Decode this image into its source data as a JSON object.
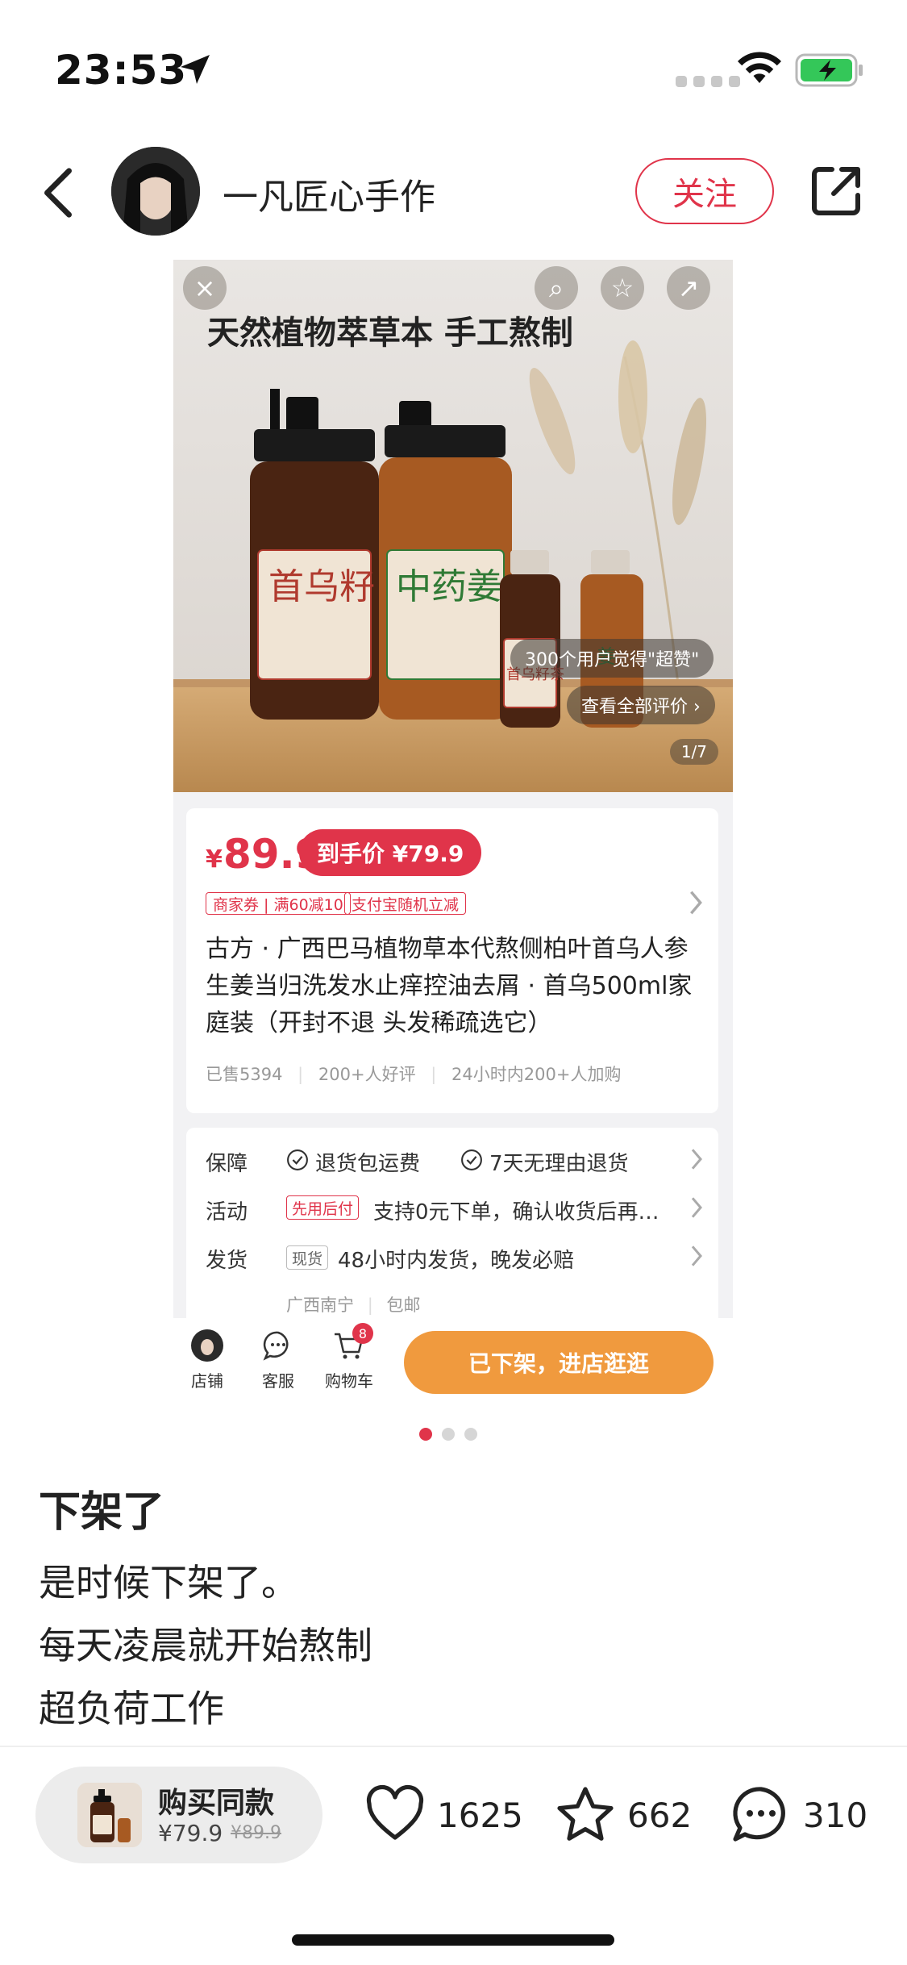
{
  "status_bar": {
    "time": "23:53"
  },
  "nav": {
    "shop_name": "一凡匠心手作",
    "follow_label": "关注"
  },
  "product": {
    "banner": "天然植物萃草本 手工熬制",
    "bottle_labels": [
      "首乌籽",
      "中药姜",
      "首乌籽茶",
      "姜"
    ],
    "review_bubble": "300个用户觉得\"超赞\"",
    "all_reviews": "查看全部评价 ›",
    "page_indicator": "1/7",
    "price_symbol": "¥",
    "price": "89.9",
    "deal_price": "到手价 ¥79.9",
    "coupons": [
      "商家券 | 满60减10",
      "支付宝随机立减"
    ],
    "title": "古方 · 广西巴马植物草本代熬侧柏叶首乌人参生姜当归洗发水止痒控油去屑 · 首乌500ml家庭装（开封不退 头发稀疏选它）",
    "sold": "已售5394",
    "good_reviews": "200+人好评",
    "recent": "24小时内200+人加购",
    "service": {
      "guarantee_label": "保障",
      "guarantee_1": "退货包运费",
      "guarantee_2": "7天无理由退货",
      "activity_label": "活动",
      "activity_tag": "先用后付",
      "activity_text": "支持0元下单，确认收货后再…",
      "ship_label": "发货",
      "ship_tag": "现货",
      "ship_text": "48小时内发货，晚发必赔",
      "ship_origin": "广西南宁",
      "ship_free": "包邮"
    },
    "bottom": {
      "shop": "店铺",
      "service": "客服",
      "cart": "购物车",
      "cart_count": "8",
      "offline_button": "已下架，进店逛逛"
    }
  },
  "carousel": {
    "count": 3,
    "active": 1
  },
  "post": {
    "title": "下架了",
    "lines": [
      "是时候下架了。",
      "每天凌晨就开始熬制",
      "超负荷工作"
    ]
  },
  "footer": {
    "buy_label": "购买同款",
    "buy_price": "¥79.9",
    "buy_orig": "¥89.9",
    "likes": "1625",
    "favorites": "662",
    "comments": "310"
  },
  "colors": {
    "accent": "#e0344a",
    "orange": "#f09a3e"
  }
}
